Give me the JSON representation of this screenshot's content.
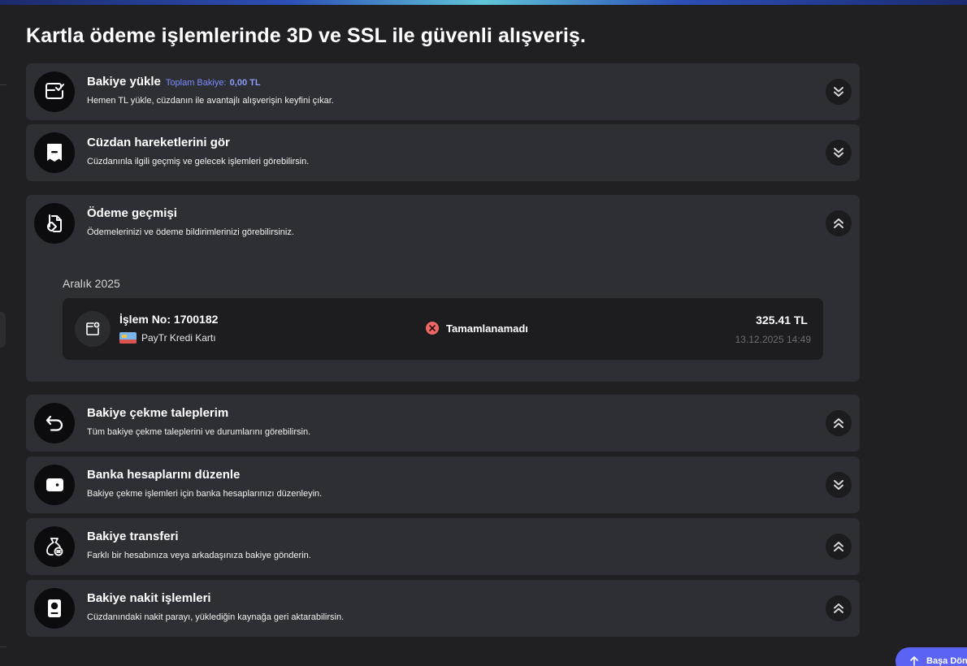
{
  "page": {
    "title": "Kartla ödeme işlemlerinde 3D ve SSL ile güvenli alışveriş."
  },
  "cards": [
    {
      "title": "Bakiye yükle",
      "balance_label": "Toplam Bakiye:",
      "balance_value": "0,00 TL",
      "desc": "Hemen TL yükle, cüzdanın ile avantajlı alışverişin keyfini çıkar.",
      "icon": "wallet-check-icon",
      "toggle": "chevron-double-down-icon"
    },
    {
      "title": "Cüzdan hareketlerini gör",
      "desc": "Cüzdanınla ilgili geçmiş ve gelecek işlemleri görebilirsin.",
      "icon": "receipt-icon",
      "toggle": "chevron-double-down-icon"
    },
    {
      "title": "Ödeme geçmişi",
      "desc": "Ödemelerinizi ve ödeme bildirimlerinizi görebilirsiniz.",
      "icon": "payment-history-icon",
      "toggle": "chevron-double-up-icon",
      "month": "Aralık 2025",
      "transaction": {
        "number": "İşlem No: 1700182",
        "method": "PayTr Kredi Kartı",
        "status": "Tamamlanamadı",
        "amount": "325.41 TL",
        "date": "13.12.2025 14:49"
      }
    },
    {
      "title": "Bakiye çekme taleplerim",
      "desc": "Tüm bakiye çekme taleplerini ve durumlarını görebilirsin.",
      "icon": "undo-arrow-icon",
      "toggle": "chevron-double-up-icon"
    },
    {
      "title": "Banka hesaplarını düzenle",
      "desc": "Bakiye çekme işlemleri için banka hesaplarınızı düzenleyin.",
      "icon": "wallet-icon",
      "toggle": "chevron-double-down-icon"
    },
    {
      "title": "Bakiye transferi",
      "desc": "Farklı bir hesabınıza veya arkadaşınıza bakiye gönderin.",
      "icon": "money-bag-transfer-icon",
      "toggle": "chevron-double-up-icon"
    },
    {
      "title": "Bakiye nakit işlemleri",
      "desc": "Cüzdanındaki nakit parayı, yüklediğin kaynağa geri aktarabilirsin.",
      "icon": "cash-icon",
      "toggle": "chevron-double-up-icon"
    }
  ],
  "back_to_top": {
    "label": "Başa Dön",
    "icon": "arrow-up-icon"
  },
  "colors": {
    "background": "#202023",
    "card": "#2e2f34",
    "accent": "#5b63f5",
    "balance": "#7b8cff",
    "error": "#ef6767"
  }
}
